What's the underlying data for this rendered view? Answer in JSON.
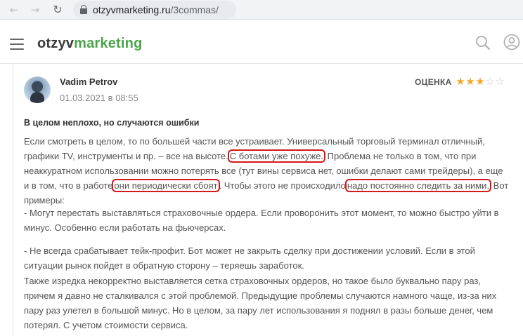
{
  "browser": {
    "url_domain": "otzyvmarketing.ru",
    "url_path": "/3commas/"
  },
  "site": {
    "logo_part1": "otzyv",
    "logo_part2": "marketing",
    "accent_color": "#4aa54a"
  },
  "review": {
    "author": "Vadim Petrov",
    "date": "01.03.2021 в 08:55",
    "rating_label": "ОЦЕНКА",
    "rating": 3,
    "rating_max": 5,
    "title": "В целом неплохо, но случаются ошибки",
    "p1_a": "Если смотреть в целом, то по большей части все устраивает. Универсальный торговый терминал отличный, графики TV, инструменты и пр. – все на высоте.",
    "p1_hl1": "С ботами уже похуже.",
    "p1_b": " Проблема не только в том, что при неаккуратном использовании можно потерять все (тут вины сервиса нет, ошибки делают сами трейдеры), а еще и в том, что в работе",
    "p1_hl2": "они периодически сбоят",
    "p1_c": ". Чтобы этого не происходило",
    "p1_hl3": "надо постоянно следить за ними.",
    "p1_d": " Вот примеры:",
    "p2": "- Могут перестать выставляться страховочные ордера. Если проворонить этот момент, то можно быстро уйти в минус. Особенно если работать на фьючерсах.",
    "p3": "- Не всегда срабатывает тейк-профит. Бот может не закрыть сделку при достижении условий. Если в этой ситуации рынок пойдет в обратную сторону – теряешь заработок.",
    "p4": "Также изредка некорректно выставляется сетка страховочных ордеров, но такое было буквально пару раз, причем я давно не сталкивался с этой проблемой. Предыдущие проблемы случаются намного чаще, из-за них пару раз улетел в большой минус. Но в целом, за пару лет использования я поднял в разы больше денег, чем потерял. С учетом стоимости сервиса.",
    "highlight_color": "#d21b1b",
    "star_color": "#f4a623"
  },
  "icons": [
    "back-arrow-icon",
    "forward-arrow-icon",
    "reload-icon",
    "lock-icon",
    "hamburger-menu-icon",
    "search-icon",
    "user-icon",
    "star-icon"
  ]
}
